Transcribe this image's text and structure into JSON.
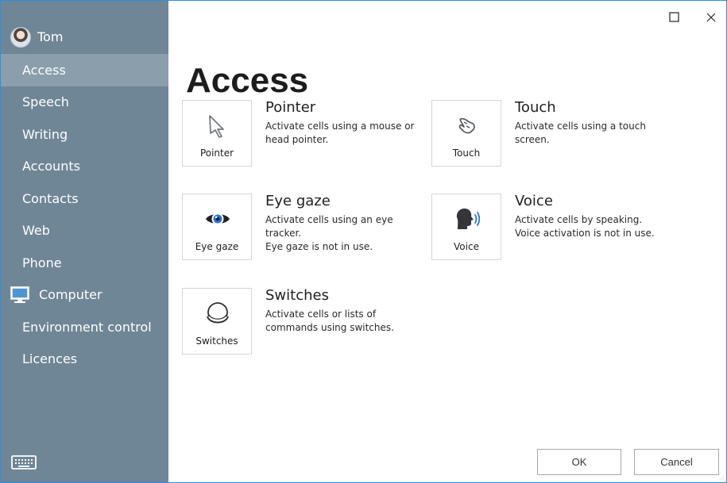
{
  "user": {
    "name": "Tom",
    "avatar_icon": "user-avatar-icon"
  },
  "sidebar": {
    "items": [
      {
        "label": "Access",
        "active": true
      },
      {
        "label": "Speech"
      },
      {
        "label": "Writing"
      },
      {
        "label": "Accounts"
      },
      {
        "label": "Contacts"
      },
      {
        "label": "Web"
      },
      {
        "label": "Phone"
      },
      {
        "label": "Computer",
        "icon": "computer-icon"
      },
      {
        "label": "Environment control"
      },
      {
        "label": "Licences"
      }
    ],
    "bottom_icon": "keyboard-icon"
  },
  "window": {
    "maximize_icon": "maximize-icon",
    "close_icon": "close-icon"
  },
  "main": {
    "title": "Access",
    "options": [
      {
        "key": "pointer",
        "tile_label": "Pointer",
        "title": "Pointer",
        "description": "Activate cells using a mouse or head pointer.",
        "icon": "pointer-arrow-icon"
      },
      {
        "key": "touch",
        "tile_label": "Touch",
        "title": "Touch",
        "description": "Activate cells using a touch screen.",
        "icon": "touch-hand-icon"
      },
      {
        "key": "eye-gaze",
        "tile_label": "Eye gaze",
        "title": "Eye gaze",
        "description": "Activate cells using an eye tracker.",
        "status": "Eye gaze is not in use.",
        "icon": "eye-icon"
      },
      {
        "key": "voice",
        "tile_label": "Voice",
        "title": "Voice",
        "description": "Activate cells by speaking.",
        "status": "Voice activation is not in use.",
        "icon": "voice-speaking-head-icon"
      },
      {
        "key": "switches",
        "tile_label": "Switches",
        "title": "Switches",
        "description": "Activate cells or lists of commands using switches.",
        "icon": "switch-button-icon"
      }
    ]
  },
  "footer": {
    "ok_label": "OK",
    "cancel_label": "Cancel"
  },
  "colors": {
    "sidebar": "#6f8696",
    "sidebar_active": "#8a9eac",
    "window_border": "#2f8fde",
    "accent_blue": "#2f74d0"
  }
}
